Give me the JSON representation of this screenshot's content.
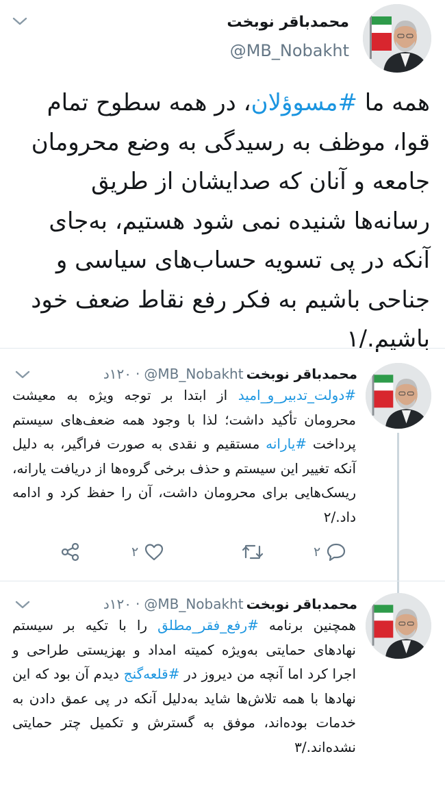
{
  "main_tweet": {
    "name": "محمدباقر نوبخت",
    "handle": "@MB_Nobakht",
    "body_before": "همه ما ",
    "hashtag": "#مسوؤلان",
    "body_after": "، در همه سطوح تمام قوا، موظف به رسیدگی به وضع محرومان جامعه و آنان که صدایشان از طریق رسانه‌ها شنیده نمی شود هستیم، به‌جای آنکه در پی تسویه حساب‌های سیاسی و جناحی باشیم به فکر رفع نقاط ضعف خود باشیم./۱"
  },
  "replies": [
    {
      "name": "محمدباقر نوبخت",
      "handle": "@MB_Nobakht",
      "time": "۱۲۰د",
      "dot": "·",
      "hashtag1": "#دولت_تدبیر_و_امید",
      "text1": " از ابتدا بر توجه ویژه به معیشت محرومان تأکید داشت؛ لذا با وجود همه ضعف‌های سیستم پرداخت ",
      "hashtag2": "#یارانه",
      "text2": " مستقیم و نقدی به صورت فراگیر، به دلیل آنکه تغییر این سیستم و حذف برخی گروه‌ها از دریافت یارانه، ریسک‌هایی برای محرومان داشت، آن را حفظ کرد و ادامه داد./۲",
      "reply_count": "۲",
      "like_count": "۲"
    },
    {
      "name": "محمدباقر نوبخت",
      "handle": "@MB_Nobakht",
      "time": "۱۲۰د",
      "dot": "·",
      "text0": "همچنین برنامه ",
      "hashtag1": "#رفع_فقر_مطلق",
      "text1": " را با تکیه بر سیستم نهادهای حمایتی به‌ویژه کمیته امداد و بهزیستی طراحی و اجرا کرد اما آنچه من دیروز در ",
      "hashtag2": "#قلعه‌گنج",
      "text2": " دیدم آن بود که این نهادها با همه تلاش‌ها شاید به‌دلیل آنکه در پی عمق دادن به خدمات بوده‌اند، موفق به گسترش و تکمیل چتر حمایتی نشده‌اند./۳"
    }
  ],
  "icons": [
    "chevron-down-icon",
    "reply-icon",
    "retweet-icon",
    "like-icon",
    "share-icon"
  ],
  "colors": {
    "link": "#1b95e0",
    "secondary": "#657786",
    "divider": "#e1e8ed",
    "thread": "#ccd6dd"
  }
}
